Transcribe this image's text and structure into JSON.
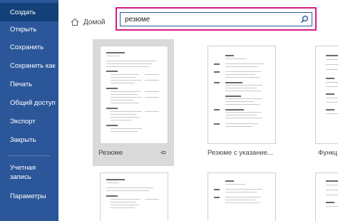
{
  "sidebar": {
    "items": [
      {
        "label": "Создать"
      },
      {
        "label": "Открыть"
      },
      {
        "label": "Сохранить"
      },
      {
        "label": "Сохранить как"
      },
      {
        "label": "Печать"
      },
      {
        "label": "Общий доступ"
      },
      {
        "label": "Экспорт"
      },
      {
        "label": "Закрыть"
      },
      {
        "label": "Учетная запись",
        "line1": "Учетная",
        "line2": "запись"
      },
      {
        "label": "Параметры"
      }
    ],
    "active": "Создать"
  },
  "breadcrumb": {
    "home_label": "Домой"
  },
  "search": {
    "value": "резюме"
  },
  "templates": [
    {
      "label": "Резюме",
      "pinned": true,
      "selected": true
    },
    {
      "label": "Резюме с указание..."
    },
    {
      "label": "Функц"
    }
  ],
  "colors": {
    "sidebar": "#2b579a",
    "sidebar_active": "#124078",
    "search_highlight": "#d81b86"
  }
}
